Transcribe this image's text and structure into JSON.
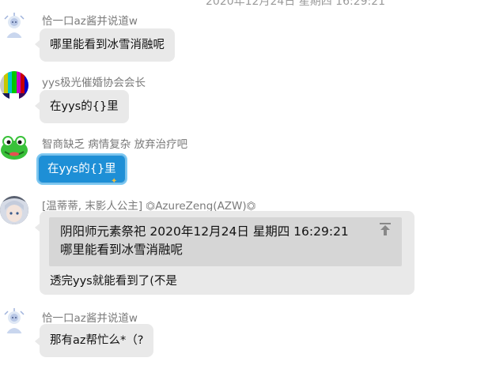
{
  "top_timestamp": "2020年12月24日 星期四 16:29:21",
  "messages": [
    {
      "sender": "恰一口az酱并说道w",
      "text": "哪里能看到冰雪消融呢",
      "avatar_icon": "snow-character-avatar"
    },
    {
      "sender": "yys极光催婚协会会长",
      "text": "在yys的{}里",
      "avatar_icon": "color-bars-avatar"
    },
    {
      "sender": "智商缺乏 病情复杂 放弃治疗吧",
      "text": "在yys的{}里",
      "avatar_icon": "frog-avatar",
      "bubble_color": "#1e8fd6"
    },
    {
      "sender": "[温蒂蒂, 末影人公主] ⏣AzureZeng(AZW)⏣",
      "avatar_icon": "anime-character-avatar",
      "reply": {
        "quote_header": "阴阳师元素祭祀  2020年12月24日 星期四 16:29:21",
        "quote_text": "哪里能看到冰雪消融呢",
        "jump_icon": "jump-to-top-icon"
      },
      "text": "透完yys就能看到了(不是"
    },
    {
      "sender": "恰一口az酱并说道w",
      "text": "那有az帮忙么*（?",
      "avatar_icon": "snow-character-avatar"
    }
  ]
}
